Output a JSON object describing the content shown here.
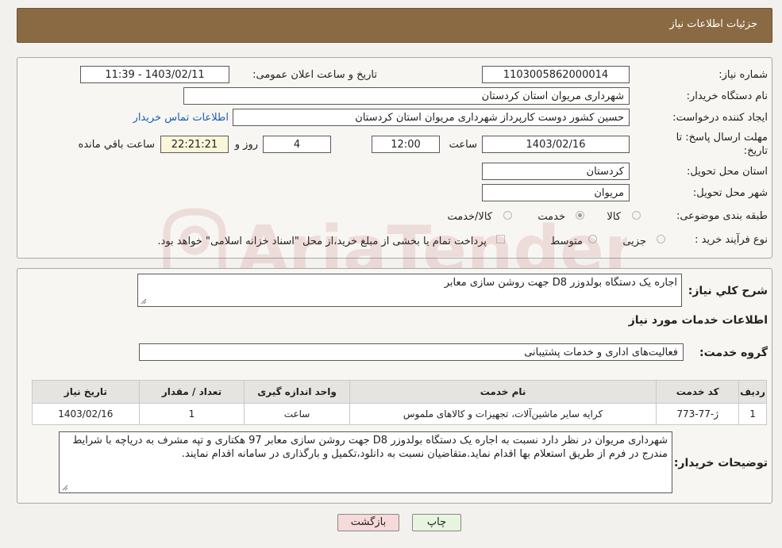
{
  "header": {
    "title": "جزئیات اطلاعات نیاز"
  },
  "form": {
    "need_number_label": "شماره نیاز:",
    "need_number": "1103005862000014",
    "announce_label": "تاریخ و ساعت اعلان عمومی:",
    "announce_value": "1403/02/11 - 11:39",
    "buyer_org_label": "نام دستگاه خریدار:",
    "buyer_org": "شهرداری مریوان استان کردستان",
    "creator_label": "ایجاد کننده درخواست:",
    "creator": "حسین کشور دوست کارپرداز شهرداری مریوان استان کردستان",
    "contact_link": "اطلاعات تماس خریدار",
    "deadline_label_1": "مهلت ارسال پاسخ: تا",
    "deadline_label_2": "تاریخ:",
    "deadline_date": "1403/02/16",
    "time_label": "ساعت",
    "deadline_time": "12:00",
    "days_value": "4",
    "days_label": "روز و",
    "remaining_time": "22:21:21",
    "remaining_label": "ساعت باقي مانده",
    "province_label": "استان محل تحویل:",
    "province": "کردستان",
    "city_label": "شهر محل تحویل:",
    "city": "مریوان",
    "category_label": "طبقه بندی موضوعی:",
    "category_options": [
      "کالا",
      "خدمت",
      "کالا/خدمت"
    ],
    "category_selected": "خدمت",
    "process_label": "نوع فرآیند خرید :",
    "process_options": [
      "جزیی",
      "متوسط"
    ],
    "payment_note": "پرداخت تمام یا بخشی از مبلغ خرید،از محل \"اسناد خزانه اسلامی\" خواهد بود."
  },
  "summary": {
    "label": "شرح کلي نياز:",
    "value": "اجاره یک دستگاه بولدوزر D8 جهت روشن سازی معابر"
  },
  "services": {
    "section_title": "اطلاعات خدمات مورد نیاز",
    "group_label": "گروه خدمت:",
    "group_value": "فعالیت‌های اداری و خدمات پشتیبانی",
    "columns": [
      "ردیف",
      "کد خدمت",
      "نام خدمت",
      "واحد اندازه گیری",
      "تعداد / مقدار",
      "تاریخ نیاز"
    ],
    "rows": [
      [
        "1",
        "ژ-77-773",
        "کرایه سایر ماشین‌آلات، تجهیزات و کالاهای ملموس",
        "ساعت",
        "1",
        "1403/02/16"
      ]
    ]
  },
  "buyer_notes": {
    "label": "توضیحات خریدار:",
    "value": "شهرداری مریوان در نظر دارد نسبت به اجاره یک دستگاه بولدوزر D8 جهت روشن سازی معابر 97 هکتاری و تپه مشرف به دریاچه با شرایط مندرج در فرم از طریق استعلام بها اقدام نماید.متقاضیان نسبت به دانلود،تکمیل و بارگذاری در سامانه اقدام نمایند."
  },
  "buttons": {
    "print": "چاپ",
    "back": "بازگشت"
  },
  "watermark": {
    "text": "AriaTender.neT"
  },
  "colors": {
    "header_bg": "#8a6a42",
    "link": "#1a5fb4",
    "back_button_bg": "#f6d9d9",
    "print_button_bg": "#e7f5e0"
  }
}
